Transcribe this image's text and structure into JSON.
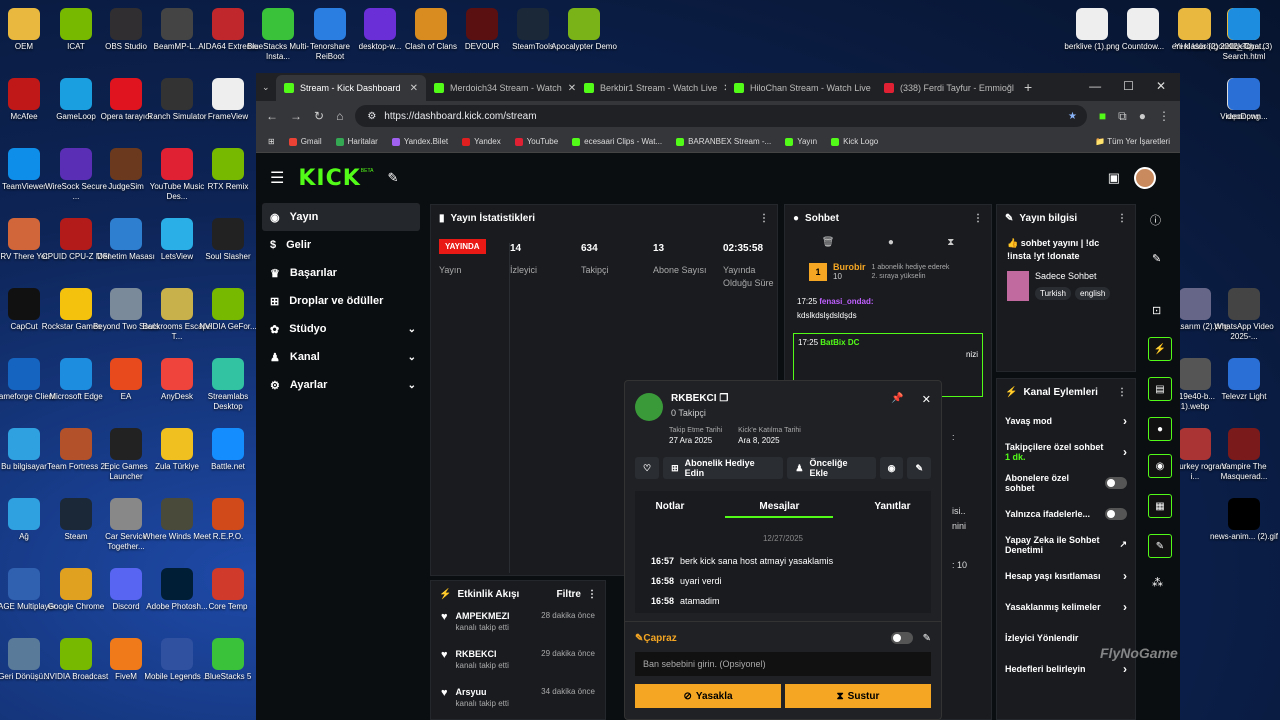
{
  "desktop_icons": [
    {
      "label": "OEM",
      "color": "#e8b93e"
    },
    {
      "label": "ICAT",
      "color": "#76b900"
    },
    {
      "label": "OBS Studio",
      "color": "#302e31"
    },
    {
      "label": "BeamMP-L...",
      "color": "#444"
    },
    {
      "label": "AIDA64 Extreme",
      "color": "#c0272d"
    },
    {
      "label": "BlueStacks Multi-Insta...",
      "color": "#3ac23a"
    },
    {
      "label": "Tenorshare ReiBoot",
      "color": "#2a7de1"
    },
    {
      "label": "desktop-w...",
      "color": "#6a2fd6"
    },
    {
      "label": "Clash of Clans",
      "color": "#d98c1f"
    },
    {
      "label": "DEVOUR",
      "color": "#5a1010"
    },
    {
      "label": "SteamTools",
      "color": "#1b2838"
    },
    {
      "label": "Apocalypter Demo",
      "color": "#7ab317"
    },
    {
      "label": "McAfee",
      "color": "#c01818"
    },
    {
      "label": "GameLoop",
      "color": "#1aa0e0"
    },
    {
      "label": "Opera tarayıcı",
      "color": "#e0141e"
    },
    {
      "label": "Ranch Simulator",
      "color": "#333"
    },
    {
      "label": "FrameView",
      "color": "#eee"
    },
    {
      "label": "TeamViewer",
      "color": "#0e8ee9"
    },
    {
      "label": "WireSock Secure ...",
      "color": "#5a2fb5"
    },
    {
      "label": "JudgeSim",
      "color": "#6b3a1e"
    },
    {
      "label": "YouTube Music Des...",
      "color": "#e02033"
    },
    {
      "label": "RTX Remix",
      "color": "#76b900"
    },
    {
      "label": "RV There Yet",
      "color": "#d0663a"
    },
    {
      "label": "CPUID CPU-Z MSI",
      "color": "#b31b1b"
    },
    {
      "label": "Denetim Masası",
      "color": "#2f7fd0"
    },
    {
      "label": "LetsView",
      "color": "#2ab0e6"
    },
    {
      "label": "Soul Slasher",
      "color": "#222"
    },
    {
      "label": "CapCut",
      "color": "#111"
    },
    {
      "label": "Rockstar Games ...",
      "color": "#f4c20d"
    },
    {
      "label": "Beyond Two Souls",
      "color": "#7a8a9a"
    },
    {
      "label": "Backrooms Escape T...",
      "color": "#c8b04a"
    },
    {
      "label": "NVIDIA GeFor...",
      "color": "#76b900"
    },
    {
      "label": "Gameforge Client",
      "color": "#1565c0"
    },
    {
      "label": "Microsoft Edge",
      "color": "#1d8de0"
    },
    {
      "label": "EA",
      "color": "#e8491d"
    },
    {
      "label": "AnyDesk",
      "color": "#ef443b"
    },
    {
      "label": "Streamlabs Desktop",
      "color": "#31c3a2"
    },
    {
      "label": "Bu bilgisayar",
      "color": "#2fa0e0"
    },
    {
      "label": "Team Fortress 2",
      "color": "#b3512b"
    },
    {
      "label": "Epic Games Launcher",
      "color": "#222"
    },
    {
      "label": "Zula Türkiye",
      "color": "#f0c020"
    },
    {
      "label": "Battle.net",
      "color": "#148eff"
    },
    {
      "label": "Ağ",
      "color": "#2fa0e0"
    },
    {
      "label": "Steam",
      "color": "#1b2838"
    },
    {
      "label": "Car Service Together...",
      "color": "#888"
    },
    {
      "label": "Where Winds Meet",
      "color": "#4a4a3a"
    },
    {
      "label": "R.E.P.O.",
      "color": "#d04a1a"
    },
    {
      "label": "RAGE Multiplayer",
      "color": "#3060b0"
    },
    {
      "label": "Google Chrome",
      "color": "#e0a020"
    },
    {
      "label": "Discord",
      "color": "#5865f2"
    },
    {
      "label": "Adobe Photosh...",
      "color": "#001e36"
    },
    {
      "label": "Core Temp",
      "color": "#d03a2a"
    },
    {
      "label": "Geri Dönüşü...",
      "color": "#5a7a9a"
    },
    {
      "label": "NVIDIA Broadcast",
      "color": "#76b900"
    },
    {
      "label": "FiveM",
      "color": "#f07a1a"
    },
    {
      "label": "Mobile Legends ...",
      "color": "#3050a0"
    },
    {
      "label": "BlueStacks 5",
      "color": "#3ac23a"
    },
    {
      "label": "berklive (1).png",
      "color": "#eee"
    },
    {
      "label": "Countdow...",
      "color": "#eee"
    },
    {
      "label": "Yeni klasör",
      "color": "#e8b93e"
    },
    {
      "label": "goodbyedp... (3)",
      "color": "#e8b93e"
    },
    {
      "label": "rapor.png",
      "color": "#ddd"
    },
    {
      "label": "2012_Toyot...",
      "color": "#e8b93e"
    },
    {
      "label": "eni klasör (2)",
      "color": "#e8b93e"
    },
    {
      "label": "Kick Chat Search.html",
      "color": "#1d8de0"
    },
    {
      "label": "VideoDown...",
      "color": "#2a6fd6"
    },
    {
      "label": "siz tasarım (2).png",
      "color": "#668"
    },
    {
      "label": "WhatsApp Video 2025-...",
      "color": "#444"
    },
    {
      "label": "119e40-b... 1).webp",
      "color": "#555"
    },
    {
      "label": "Televzr Light",
      "color": "#2a6fd6"
    },
    {
      "label": "rezTurkey rogram i...",
      "color": "#a33"
    },
    {
      "label": "Vampire The Masquerad...",
      "color": "#7a1a1a"
    },
    {
      "label": "news-anim... (2).gif",
      "color": "#000"
    }
  ],
  "browser": {
    "tabs": [
      "Stream - Kick Dashboard",
      "Merdoich34 Stream - Watch",
      "Berkbir1 Stream - Watch Live",
      "HiloChan Stream - Watch Live",
      "(338) Ferdi Tayfur - Emmioğl"
    ],
    "url": "https://dashboard.kick.com/stream",
    "bookmarks": [
      "Gmail",
      "Haritalar",
      "Yandex.Bilet",
      "Yandex",
      "YouTube",
      "ecesaari Clips - Wat...",
      "BARANBEX Stream -...",
      "Yayın",
      "Kick Logo"
    ],
    "all_bookmarks": "Tüm Yer İşaretleri"
  },
  "kick": {
    "logo": "KICK",
    "beta": "BETA",
    "nav": [
      {
        "label": "Yayın",
        "icon": "radio-icon"
      },
      {
        "label": "Gelir",
        "icon": "dollar-icon"
      },
      {
        "label": "Başarılar",
        "icon": "trophy-icon"
      },
      {
        "label": "Droplar ve ödüller",
        "icon": "gift-icon"
      },
      {
        "label": "Stüdyo",
        "icon": "palette-icon"
      },
      {
        "label": "Kanal",
        "icon": "user-icon"
      },
      {
        "label": "Ayarlar",
        "icon": "gear-icon"
      }
    ],
    "stats": {
      "title": "Yayın İstatistikleri",
      "live_badge": "YAYINDA",
      "live_label": "Yayın",
      "items": [
        {
          "value": "14",
          "label": "İzleyici"
        },
        {
          "value": "634",
          "label": "Takipçi"
        },
        {
          "value": "13",
          "label": "Abone Sayısı"
        },
        {
          "value": "02:35:58",
          "label": "Yayında Olduğu Süre"
        }
      ]
    },
    "chat": {
      "title": "Sohbet",
      "gift_user": "Burobir",
      "gift_level": "10",
      "gift_text": "1 abonelik hediye ederek 2. sıraya yükselin",
      "msg_time": "17:25",
      "msg_user": "fenasi_ondad:",
      "msg_text": "kdslkdslşdsldşds",
      "msg2_time": "17:25",
      "msg2_user": "BatBix DC",
      "msg2_frag": "nizi",
      "timestamps": [
        ":",
        "isi..",
        "nini",
        ": 10",
        ":",
        ":",
        ":",
        ":"
      ]
    },
    "stream_info": {
      "title": "Yayın bilgisi",
      "stream_title": "👍 sohbet yayını | !dc !insta !yt !donate",
      "category": "Sadece Sohbet",
      "tags": [
        "Turkish",
        "english"
      ]
    },
    "activity": {
      "title": "Etkinlik Akışı",
      "filter": "Filtre",
      "items": [
        {
          "name": "AMPEKMEZI",
          "sub": "kanalı takip etti",
          "time": "28 dakika önce"
        },
        {
          "name": "RKBEKCI",
          "sub": "kanalı takip etti",
          "time": "29 dakika önce"
        },
        {
          "name": "Arsyuu",
          "sub": "kanalı takip etti",
          "time": "34 dakika önce"
        }
      ]
    },
    "channel_actions": {
      "title": "Kanal Eylemleri",
      "items": [
        {
          "label": "Yavaş mod",
          "type": "arrow"
        },
        {
          "label": "Takipçilere özel sohbet",
          "sub": "1 dk.",
          "type": "arrow"
        },
        {
          "label": "Abonelere özel sohbet",
          "type": "toggle"
        },
        {
          "label": "Yalnızca ifadelerle...",
          "type": "toggle"
        },
        {
          "label": "Yapay Zeka ile Sohbet Denetimi",
          "type": "ext"
        },
        {
          "label": "Hesap yaşı kısıtlaması",
          "type": "arrow"
        },
        {
          "label": "Yasaklanmış kelimeler",
          "type": "arrow"
        },
        {
          "label": "İzleyici Yönlendir",
          "type": "none"
        },
        {
          "label": "Hedefleri belirleyin",
          "type": "arrow"
        }
      ]
    },
    "popup": {
      "username": "RKBEKCI",
      "followers": "0 Takipçi",
      "follow_date_label": "Takip Etme Tarihi",
      "follow_date": "27 Ara 2025",
      "join_label": "Kick'e Katılma Tarihi",
      "join_date": "Ara 8, 2025",
      "gift_btn": "Abonelik Hediye Edin",
      "priority_btn": "Önceliğe Ekle",
      "tabs": [
        "Notlar",
        "Mesajlar",
        "Yanıtlar"
      ],
      "date": "12/27/2025",
      "messages": [
        {
          "time": "16:57",
          "text": "berk kick sana host atmayi yasaklamis"
        },
        {
          "time": "16:58",
          "text": "uyari verdi"
        },
        {
          "time": "16:58",
          "text": "atamadim"
        }
      ],
      "cross_label": "Çapraz",
      "ban_placeholder": "Ban sebebini girin. (Opsiyonel)",
      "ban_btn": "Yasakla",
      "mute_btn": "Sustur"
    },
    "watermark": "FlyNoGame"
  },
  "colors": {
    "kick_green": "#53fc18",
    "live_red": "#e91916",
    "ban_yellow": "#f5a623",
    "panel": "#191b1f"
  }
}
